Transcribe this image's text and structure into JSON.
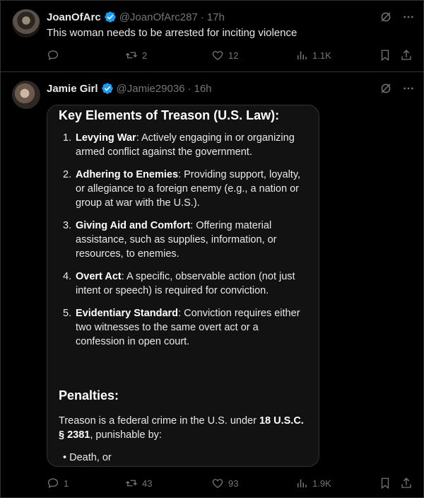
{
  "tweet1": {
    "name": "JoanOfArc",
    "handle": "@JoanOfArc287",
    "dot": "·",
    "time": "17h",
    "text": "This woman needs to be arrested for inciting violence",
    "retweets": "2",
    "likes": "12",
    "views": "1.1K"
  },
  "tweet2": {
    "name": "Jamie Girl",
    "handle": "@Jamie29036",
    "dot": "·",
    "time": "16h",
    "replies": "1",
    "retweets": "43",
    "likes": "93",
    "views": "1.9K",
    "card": {
      "title": "Key Elements of Treason (U.S. Law):",
      "items": [
        {
          "num": "1.",
          "term": "Levying War",
          "desc": ": Actively engaging in or organizing armed conflict against the government."
        },
        {
          "num": "2.",
          "term": "Adhering to Enemies",
          "desc": ": Providing support, loyalty, or allegiance to a foreign enemy (e.g., a nation or group at war with the U.S.)."
        },
        {
          "num": "3.",
          "term": "Giving Aid and Comfort",
          "desc": ": Offering material assistance, such as supplies, information, or resources, to enemies."
        },
        {
          "num": "4.",
          "term": "Overt Act",
          "desc": ": A specific, observable action (not just intent or speech) is required for conviction."
        },
        {
          "num": "5.",
          "term": "Evidentiary Standard",
          "desc": ": Conviction requires either two witnesses to the same overt act or a confession in open court."
        }
      ],
      "penalties_heading": "Penalties:",
      "penalties_pre": "Treason is a federal crime in the U.S. under ",
      "penalties_law": "18 U.S.C. § 2381",
      "penalties_post": ", punishable by:",
      "bullet": "• Death, or"
    }
  },
  "colors": {
    "background": "#000000",
    "verified": "#1d9bf0",
    "muted": "#71767b",
    "card": "#121212"
  },
  "icons": [
    "verified-badge-icon",
    "grok-icon",
    "more-icon",
    "reply-icon",
    "retweet-icon",
    "like-icon",
    "views-icon",
    "bookmark-icon",
    "share-icon"
  ]
}
